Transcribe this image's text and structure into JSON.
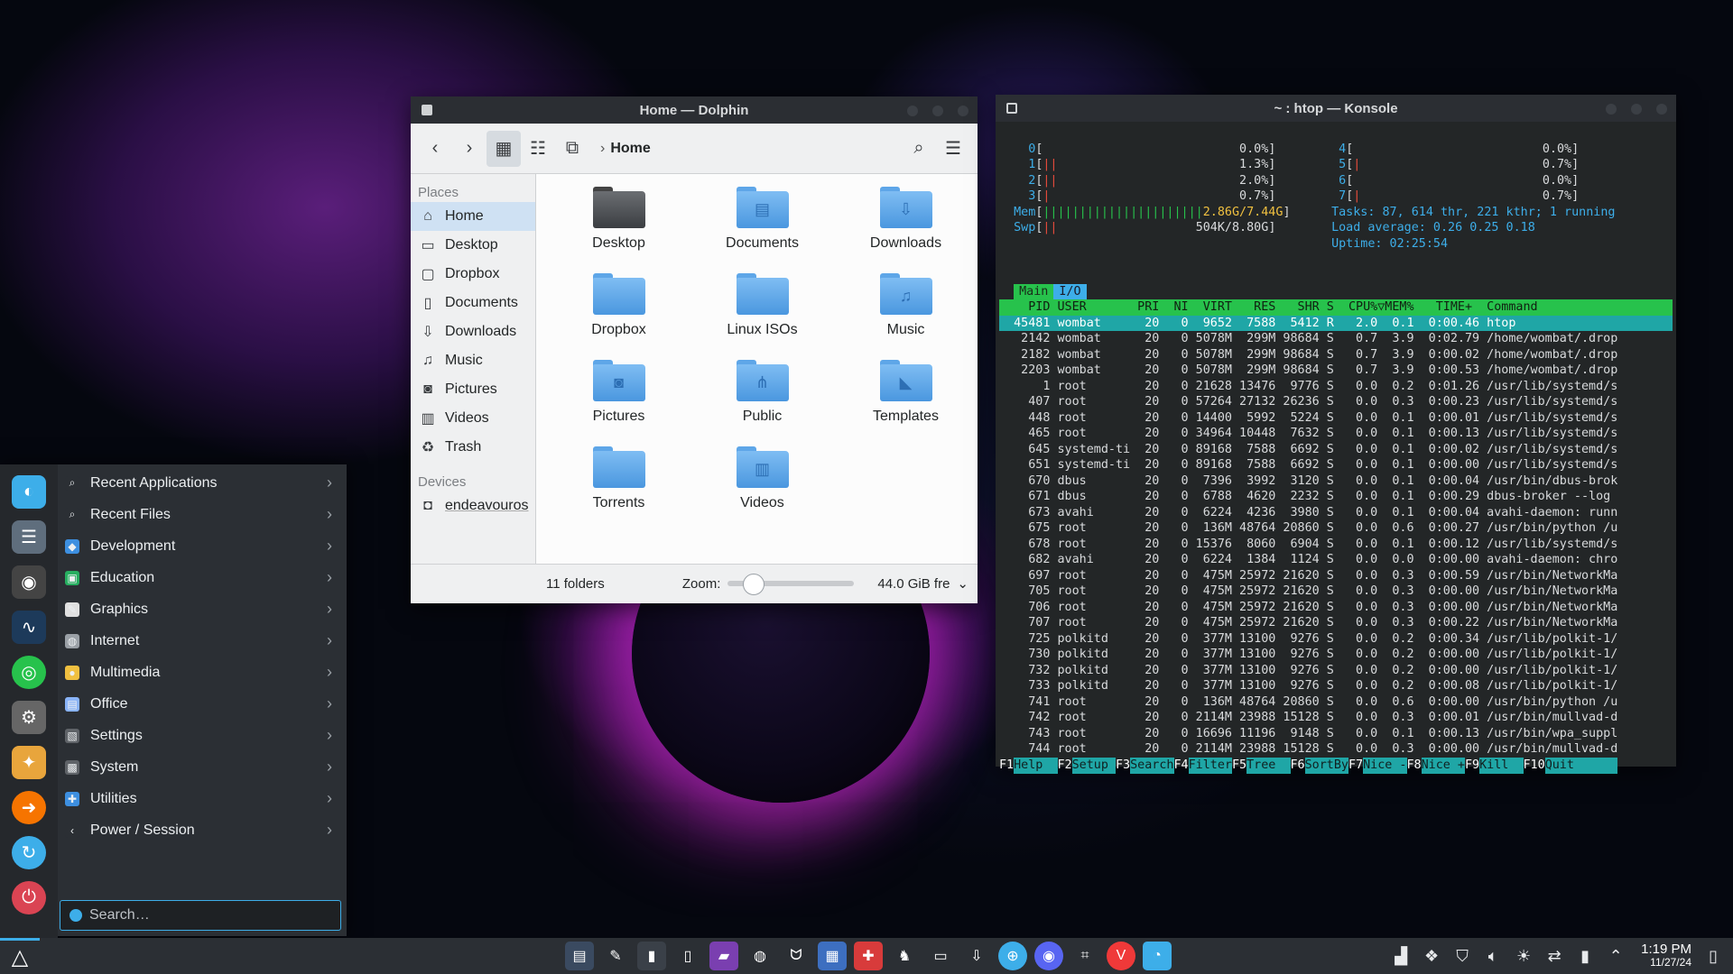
{
  "dolphin": {
    "title": "Home — Dolphin",
    "breadcrumb": "Home",
    "places_header": "Places",
    "places": [
      {
        "label": "Home",
        "icon": "home-icon"
      },
      {
        "label": "Desktop",
        "icon": "desktop-icon"
      },
      {
        "label": "Dropbox",
        "icon": "dropbox-icon"
      },
      {
        "label": "Documents",
        "icon": "document-icon"
      },
      {
        "label": "Downloads",
        "icon": "download-icon"
      },
      {
        "label": "Music",
        "icon": "music-icon"
      },
      {
        "label": "Pictures",
        "icon": "camera-icon"
      },
      {
        "label": "Videos",
        "icon": "video-icon"
      },
      {
        "label": "Trash",
        "icon": "trash-icon"
      }
    ],
    "devices_header": "Devices",
    "devices": [
      {
        "label": "endeavouros",
        "icon": "drive-icon"
      }
    ],
    "folders": [
      "Desktop",
      "Documents",
      "Downloads",
      "Dropbox",
      "Linux ISOs",
      "Music",
      "Pictures",
      "Public",
      "Templates",
      "Torrents",
      "Videos"
    ],
    "status": "11 folders",
    "zoom_label": "Zoom:",
    "zoom_level": 0.2,
    "free_space": "44.0 GiB fre"
  },
  "konsole": {
    "title": "~ : htop — Konsole",
    "cpus": [
      {
        "id": "0",
        "val": "0.0%"
      },
      {
        "id": "1",
        "val": "1.3%"
      },
      {
        "id": "2",
        "val": "2.0%"
      },
      {
        "id": "3",
        "val": "0.7%"
      },
      {
        "id": "4",
        "val": "0.0%"
      },
      {
        "id": "5",
        "val": "0.7%"
      },
      {
        "id": "6",
        "val": "0.0%"
      },
      {
        "id": "7",
        "val": "0.7%"
      }
    ],
    "mem": "2.86G/7.44G",
    "swp": "504K/8.80G",
    "tasks_line": "Tasks: 87, 614 thr, 221 kthr; 1 running",
    "load_line": "Load average: 0.26 0.25 0.18",
    "uptime_line": "Uptime: 02:25:54",
    "tab_main": "Main",
    "tab_io": "I/O",
    "header": "    PID USER       PRI  NI  VIRT   RES   SHR S  CPU%▽MEM%   TIME+  Command",
    "rows": [
      "  45481 wombat      20   0  9652  7588  5412 R   2.0  0.1  0:00.46 htop",
      "   2142 wombat      20   0 5078M  299M 98684 S   0.7  3.9  0:02.79 /home/wombat/.drop",
      "   2182 wombat      20   0 5078M  299M 98684 S   0.7  3.9  0:00.02 /home/wombat/.drop",
      "   2203 wombat      20   0 5078M  299M 98684 S   0.7  3.9  0:00.53 /home/wombat/.drop",
      "      1 root        20   0 21628 13476  9776 S   0.0  0.2  0:01.26 /usr/lib/systemd/s",
      "    407 root        20   0 57264 27132 26236 S   0.0  0.3  0:00.23 /usr/lib/systemd/s",
      "    448 root        20   0 14400  5992  5224 S   0.0  0.1  0:00.01 /usr/lib/systemd/s",
      "    465 root        20   0 34964 10448  7632 S   0.0  0.1  0:00.13 /usr/lib/systemd/s",
      "    645 systemd-ti  20   0 89168  7588  6692 S   0.0  0.1  0:00.02 /usr/lib/systemd/s",
      "    651 systemd-ti  20   0 89168  7588  6692 S   0.0  0.1  0:00.00 /usr/lib/systemd/s",
      "    670 dbus        20   0  7396  3992  3120 S   0.0  0.1  0:00.04 /usr/bin/dbus-brok",
      "    671 dbus        20   0  6788  4620  2232 S   0.0  0.1  0:00.29 dbus-broker --log",
      "    673 avahi       20   0  6224  4236  3980 S   0.0  0.1  0:00.04 avahi-daemon: runn",
      "    675 root        20   0  136M 48764 20860 S   0.0  0.6  0:00.27 /usr/bin/python /u",
      "    678 root        20   0 15376  8060  6904 S   0.0  0.1  0:00.12 /usr/lib/systemd/s",
      "    682 avahi       20   0  6224  1384  1124 S   0.0  0.0  0:00.00 avahi-daemon: chro",
      "    697 root        20   0  475M 25972 21620 S   0.0  0.3  0:00.59 /usr/bin/NetworkMa",
      "    705 root        20   0  475M 25972 21620 S   0.0  0.3  0:00.00 /usr/bin/NetworkMa",
      "    706 root        20   0  475M 25972 21620 S   0.0  0.3  0:00.00 /usr/bin/NetworkMa",
      "    707 root        20   0  475M 25972 21620 S   0.0  0.3  0:00.22 /usr/bin/NetworkMa",
      "    725 polkitd     20   0  377M 13100  9276 S   0.0  0.2  0:00.34 /usr/lib/polkit-1/",
      "    730 polkitd     20   0  377M 13100  9276 S   0.0  0.2  0:00.00 /usr/lib/polkit-1/",
      "    732 polkitd     20   0  377M 13100  9276 S   0.0  0.2  0:00.00 /usr/lib/polkit-1/",
      "    733 polkitd     20   0  377M 13100  9276 S   0.0  0.2  0:00.08 /usr/lib/polkit-1/",
      "    741 root        20   0  136M 48764 20860 S   0.0  0.6  0:00.00 /usr/bin/python /u",
      "    742 root        20   0 2114M 23988 15128 S   0.0  0.3  0:00.01 /usr/bin/mullvad-d",
      "    743 root        20   0 16696 11196  9148 S   0.0  0.1  0:00.13 /usr/bin/wpa_suppl",
      "    744 root        20   0 2114M 23988 15128 S   0.0  0.3  0:00.00 /usr/bin/mullvad-d"
    ],
    "fkeys": [
      {
        "k": "F1",
        "l": "Help  "
      },
      {
        "k": "F2",
        "l": "Setup "
      },
      {
        "k": "F3",
        "l": "Search"
      },
      {
        "k": "F4",
        "l": "Filter"
      },
      {
        "k": "F5",
        "l": "Tree  "
      },
      {
        "k": "F6",
        "l": "SortBy"
      },
      {
        "k": "F7",
        "l": "Nice -"
      },
      {
        "k": "F8",
        "l": "Nice +"
      },
      {
        "k": "F9",
        "l": "Kill  "
      },
      {
        "k": "F10",
        "l": "Quit      "
      }
    ]
  },
  "menu": {
    "categories": [
      {
        "label": "Recent Applications",
        "icon": "search-icon",
        "color": "#2b2f34"
      },
      {
        "label": "Recent Files",
        "icon": "search-icon",
        "color": "#2b2f34"
      },
      {
        "label": "Development",
        "icon": "development-icon",
        "color": "#3d8fe0"
      },
      {
        "label": "Education",
        "icon": "education-icon",
        "color": "#27ae60"
      },
      {
        "label": "Graphics",
        "icon": "graphics-icon",
        "color": "#e0e0e0"
      },
      {
        "label": "Internet",
        "icon": "internet-icon",
        "color": "#9aa0a6"
      },
      {
        "label": "Multimedia",
        "icon": "multimedia-icon",
        "color": "#f0c040"
      },
      {
        "label": "Office",
        "icon": "office-icon",
        "color": "#8ab4f8"
      },
      {
        "label": "Settings",
        "icon": "settings-icon",
        "color": "#5f6368"
      },
      {
        "label": "System",
        "icon": "system-icon",
        "color": "#5f6368"
      },
      {
        "label": "Utilities",
        "icon": "utilities-icon",
        "color": "#3d8fe0"
      },
      {
        "label": "Power / Session",
        "icon": "chevron-left-icon",
        "color": "#2b2f34"
      }
    ],
    "search_placeholder": "Search…"
  },
  "taskbar": {
    "time": "1:19 PM",
    "date": "11/27/24"
  }
}
